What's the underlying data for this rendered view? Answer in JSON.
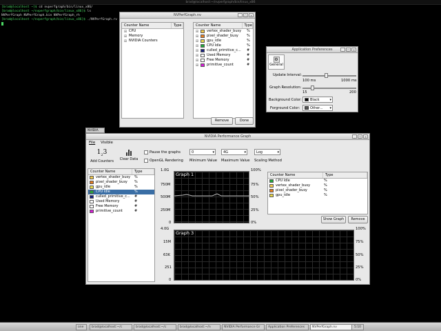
{
  "topbar": {
    "title": "brad@localhost:~/nvperfgraph/bin/linux_x86"
  },
  "terminal": {
    "lines": [
      {
        "prompt": "[brad@localhost ~]$",
        "cmd": "cd nvperfgraph/bin/linux_x86/"
      },
      {
        "prompt": "[brad@localhost ~/nvperfgraph/bin/linux_x86]$",
        "cmd": "ls"
      },
      {
        "prompt": "",
        "cmd": "NVPerfGraph  NVPerfGraph.bin  NVPerfGraph_rh"
      },
      {
        "prompt": "[brad@localhost ~/nvperfgraph/bin/linux_x86]$",
        "cmd": "./NVPerfGraph.rv"
      }
    ]
  },
  "nvperf_window": {
    "title": "NVPerfGraph.nv",
    "left_header": [
      "Counter Name",
      "Type"
    ],
    "left_items": [
      "CPU",
      "Memory",
      "NVIDIA Counters"
    ],
    "right_header": [
      "Counter Name",
      "Type"
    ],
    "right_items": [
      {
        "name": "vertex_shader_busy",
        "type": "%",
        "color": "#f2c94c"
      },
      {
        "name": "pixel_shader_busy",
        "type": "%",
        "color": "#e67e22"
      },
      {
        "name": "gpu_idle",
        "type": "%",
        "color": "#e8d84a"
      },
      {
        "name": "CPU Idle",
        "type": "%",
        "color": "#22a83a"
      },
      {
        "name": "culled_primitive_c...",
        "type": "#",
        "color": "#1a237e"
      },
      {
        "name": "Used Memory",
        "type": "#",
        "color": "#ffffff"
      },
      {
        "name": "Free Memory",
        "type": "#",
        "color": "#ffffff"
      },
      {
        "name": "primitive_count",
        "type": "#",
        "color": "#d81bd8"
      }
    ],
    "remove_label": "Remove",
    "done_label": "Done"
  },
  "prefs_window": {
    "title": "Application Preferences",
    "tab_label": "General",
    "update_label": "Update Interval:",
    "update_min": "100 ms",
    "update_max": "1000 ms",
    "resolution_label": "Graph Resolution:",
    "resolution_min": "15",
    "resolution_max": "200",
    "bg_label": "Background Color:",
    "bg_value": "Black",
    "fg_label": "Forground Color:",
    "fg_value": "Other..."
  },
  "main_window": {
    "outer_title": "NVIDIA Perf",
    "title": "NVIDIA Performance Graph",
    "menu": [
      "File",
      "Visible"
    ],
    "toolbar": {
      "add_counters": "Add Counters",
      "clear_data": "Clear Data",
      "pause_label": "Pause the graphs",
      "opengl_label": "OpenGL Rendering",
      "min_value": "0",
      "min_label": "Minimum Value",
      "max_value": "4G",
      "max_label": "Maximum Value",
      "scale_value": "Log",
      "scale_label": "Scaling Method"
    },
    "left_header": [
      "Counter Name",
      "Type"
    ],
    "left_items": [
      {
        "name": "vertex_shader_busy",
        "type": "%",
        "color": "#f2c94c"
      },
      {
        "name": "pixel_shader_busy",
        "type": "%",
        "color": "#e67e22"
      },
      {
        "name": "gpu_idle",
        "type": "%",
        "color": "#e8d84a"
      },
      {
        "name": "CPU Idle",
        "type": "%",
        "color": "#22a83a"
      },
      {
        "name": "culled_primitive_c...",
        "type": "#",
        "color": "#1a237e"
      },
      {
        "name": "Used Memory",
        "type": "#",
        "color": "#ffffff"
      },
      {
        "name": "Free Memory",
        "type": "#",
        "color": "#ffffff"
      },
      {
        "name": "primitive_count",
        "type": "#",
        "color": "#d81bd8"
      }
    ],
    "graph1": {
      "title": "Graph 1",
      "left_ticks": [
        "1.0G",
        "750M",
        "500M",
        "250M",
        "0"
      ],
      "right_ticks": [
        "100%",
        "75%",
        "50%",
        "25%",
        "0%"
      ]
    },
    "graph_counters_header": [
      "Counter Name",
      "Type"
    ],
    "graph_counters": [
      {
        "name": "CPU Idle",
        "type": "%",
        "color": "#22a83a"
      },
      {
        "name": "vertex_shader_busy",
        "type": "%",
        "color": "#f2c94c"
      },
      {
        "name": "pixel_shader_busy",
        "type": "%",
        "color": "#e67e22"
      },
      {
        "name": "gpu_idle",
        "type": "%",
        "color": "#e8d84a"
      }
    ],
    "show_graph_label": "Show Graph",
    "remove_label": "Remove",
    "graph3": {
      "title": "Graph 3",
      "left_ticks": [
        "4.0G",
        "15M",
        "63K",
        "251",
        "0"
      ],
      "right_ticks": [
        "100%",
        "75%",
        "50%",
        "25%",
        "0%"
      ]
    }
  },
  "taskbar": {
    "items": [
      "brad@localhost:~/c",
      "brad@localhost:~/c",
      "brad@localhost:~/n",
      "NVIDIA Performance Gr",
      "Application Preferences",
      "NVPerfGraph.nv"
    ],
    "workspace": "one",
    "clock": "5:10"
  }
}
